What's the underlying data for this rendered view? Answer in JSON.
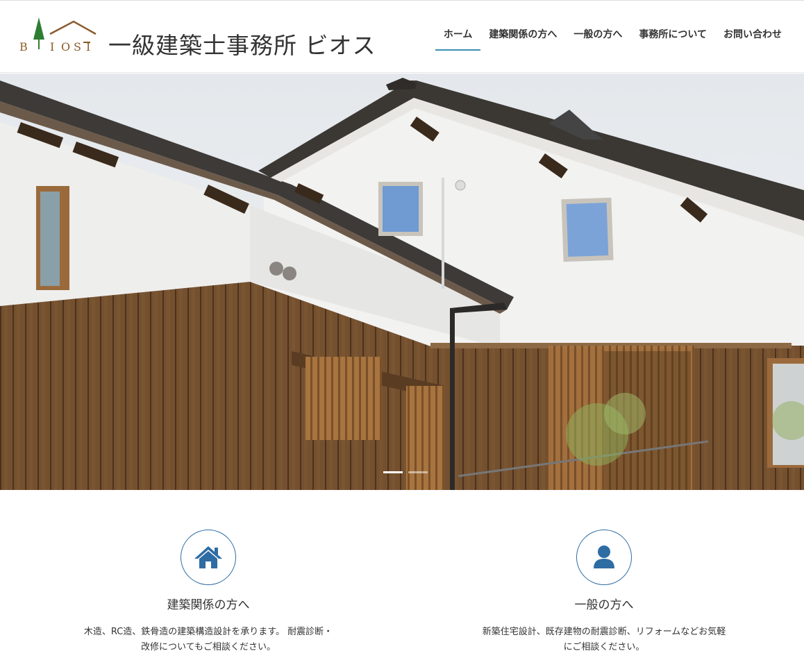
{
  "header": {
    "logo_letters": "BIOSI",
    "site_title": "一級建築士事務所 ビオス"
  },
  "nav": {
    "items": [
      {
        "label": "ホーム",
        "active": true
      },
      {
        "label": "建築関係の方へ",
        "active": false
      },
      {
        "label": "一般の方へ",
        "active": false
      },
      {
        "label": "事務所について",
        "active": false
      },
      {
        "label": "お問い合わせ",
        "active": false
      }
    ]
  },
  "hero": {
    "image": "house-exterior-photo",
    "slide_count": 2,
    "active_slide": 1
  },
  "features": [
    {
      "icon": "home-icon",
      "title": "建築関係の方へ",
      "text": "木造、RC造、鉄骨造の建築構造設計を承ります。 耐震診断・改修についてもご相談ください。"
    },
    {
      "icon": "user-icon",
      "title": "一般の方へ",
      "text": "新築住宅設計、既存建物の耐震診断、リフォームなどお気軽にご相談ください。"
    }
  ],
  "colors": {
    "accent": "#2e6ca4",
    "nav_underline": "#3a8fb0",
    "logo_tree": "#2e7d32",
    "logo_roof": "#8b5a2b"
  }
}
